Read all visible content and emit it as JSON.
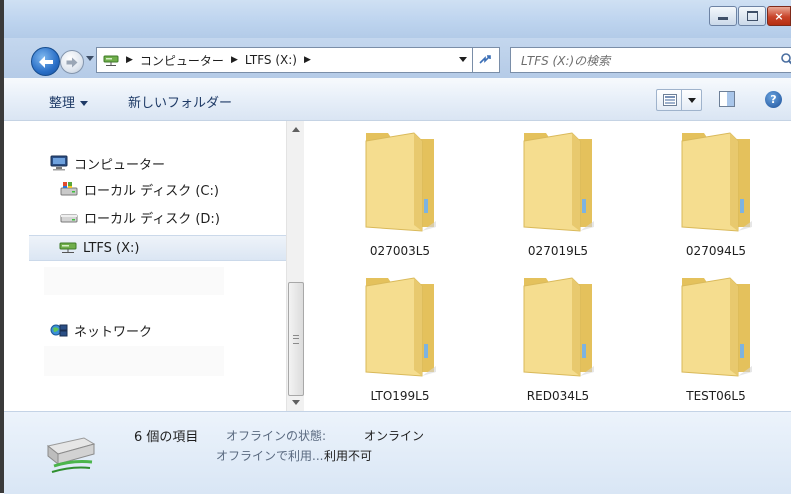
{
  "window": {
    "minimize": "minimize",
    "maximize": "maximize",
    "close": "×"
  },
  "address": {
    "path": [
      "コンピューター",
      "LTFS (X:)"
    ]
  },
  "search": {
    "placeholder": "LTFS (X:)の検索"
  },
  "toolbar": {
    "organize": "整理",
    "new_folder": "新しいフォルダー",
    "help": "?"
  },
  "nav": {
    "items": [
      {
        "label": "コンピューター",
        "icon": "computer-icon"
      },
      {
        "label": "ローカル ディスク (C:)",
        "icon": "system-drive-icon"
      },
      {
        "label": "ローカル ディスク (D:)",
        "icon": "drive-icon"
      },
      {
        "label": "LTFS (X:)",
        "icon": "network-drive-icon",
        "selected": true
      },
      {
        "label": "ネットワーク",
        "icon": "network-icon"
      }
    ]
  },
  "folders": [
    {
      "name": "027003L5"
    },
    {
      "name": "027019L5"
    },
    {
      "name": "027094L5"
    },
    {
      "name": "LTO199L5"
    },
    {
      "name": "RED034L5"
    },
    {
      "name": "TEST06L5"
    }
  ],
  "details": {
    "count": "6 個の項目",
    "status_label": "オフラインの状態:",
    "status_value": "オンライン",
    "offline_label": "オフラインで利用...",
    "offline_value": "利用不可"
  },
  "colors": {
    "accent": "#2a6fc7",
    "folder": "#f2d888",
    "selection": "#dbe6f3"
  }
}
